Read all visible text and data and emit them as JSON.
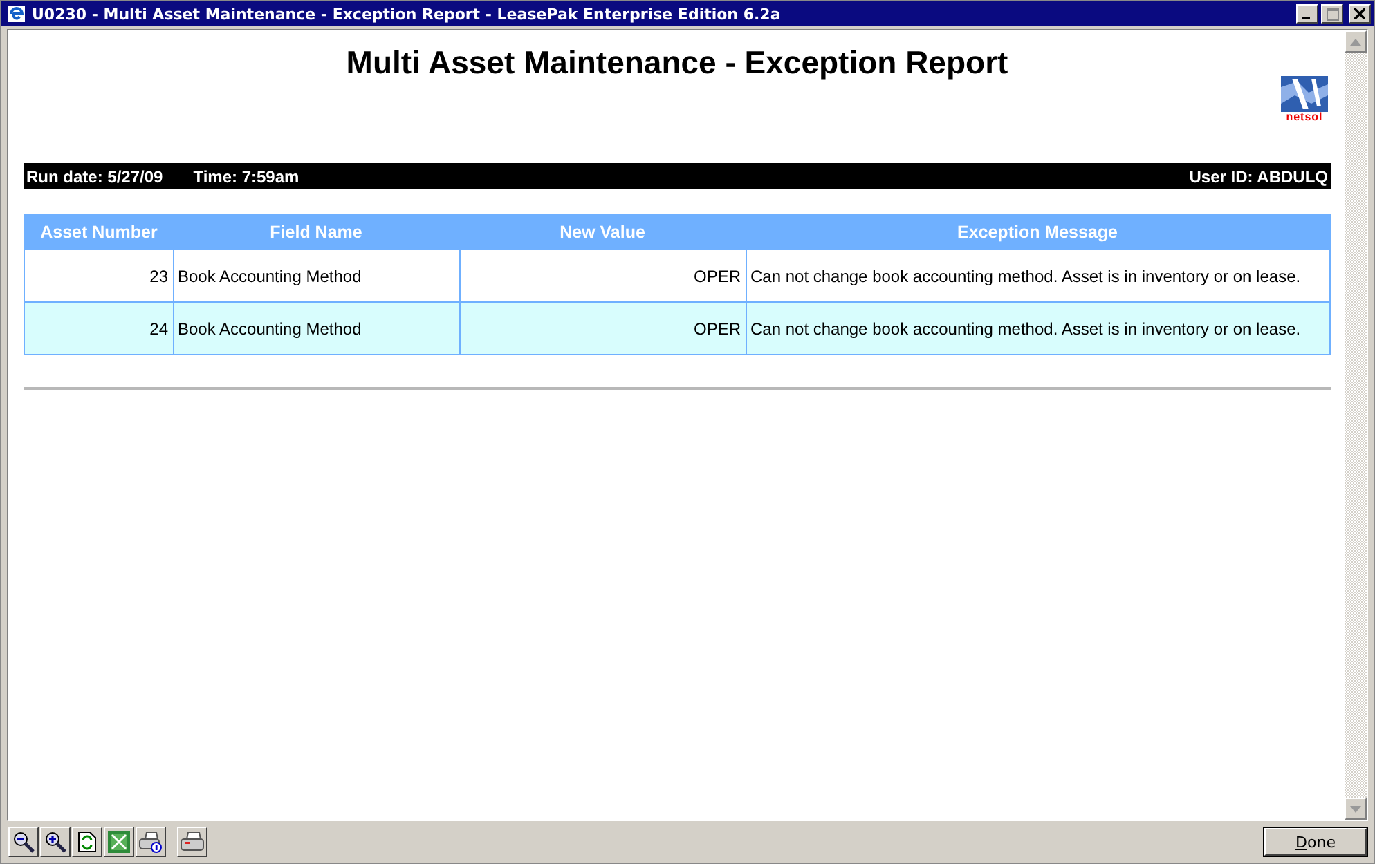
{
  "window": {
    "title": "U0230 - Multi Asset Maintenance - Exception Report - LeasePak Enterprise Edition 6.2a"
  },
  "report": {
    "title": "Multi Asset Maintenance - Exception Report",
    "logo_text": "netsol",
    "run_date": "Run date: 5/27/09",
    "time": "Time: 7:59am",
    "user_id": "User ID: ABDULQ"
  },
  "table": {
    "columns": [
      "Asset Number",
      "Field Name",
      "New Value",
      "Exception Message"
    ],
    "rows": [
      {
        "shaded": false,
        "cells": [
          "23",
          "Book Accounting Method",
          "OPER",
          "Can not change book accounting method. Asset is in inventory or on lease."
        ]
      },
      {
        "shaded": true,
        "cells": [
          "24",
          "Book Accounting Method",
          "OPER",
          "Can not change book accounting method. Asset is in inventory or on lease."
        ]
      }
    ]
  },
  "toolbar": {
    "buttons": [
      {
        "kind": "zoom-out"
      },
      {
        "kind": "zoom-in"
      },
      {
        "kind": "refresh"
      },
      {
        "kind": "spreadsheet"
      },
      {
        "kind": "print-info"
      },
      {
        "kind": "print"
      }
    ],
    "done": "Done"
  }
}
